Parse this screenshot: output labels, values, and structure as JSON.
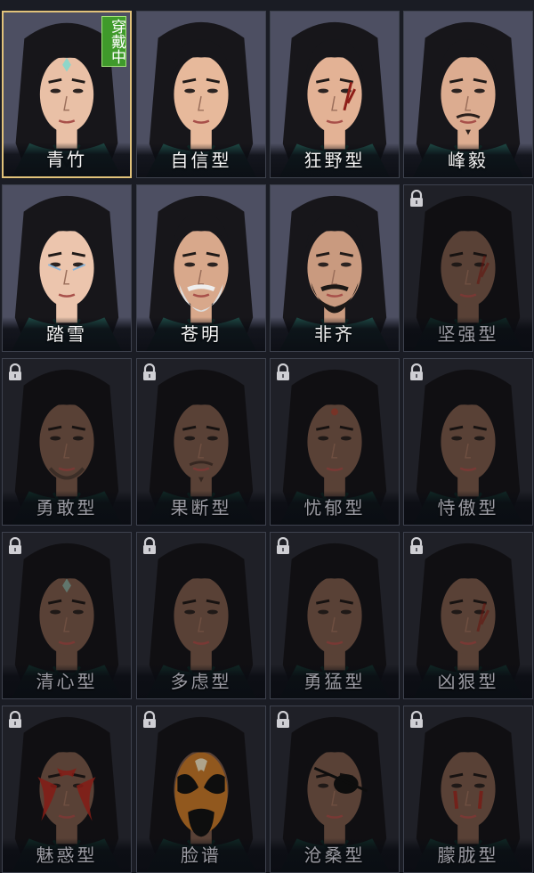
{
  "worn_badge": "穿戴中",
  "face_styles": [
    {
      "name": "青竹",
      "worn": true,
      "locked": false,
      "skin": "#e9c0a6",
      "marking": "forehead-gem"
    },
    {
      "name": "自信型",
      "worn": false,
      "locked": false,
      "skin": "#e7b99b",
      "marking": "none"
    },
    {
      "name": "狂野型",
      "worn": false,
      "locked": false,
      "skin": "#e3b295",
      "marking": "scar"
    },
    {
      "name": "峰毅",
      "worn": false,
      "locked": false,
      "skin": "#dcac90",
      "marking": "moustache"
    },
    {
      "name": "踏雪",
      "worn": false,
      "locked": false,
      "skin": "#ecc5ad",
      "marking": "eye-paint"
    },
    {
      "name": "苍明",
      "worn": false,
      "locked": false,
      "skin": "#d8a88b",
      "marking": "white-beard"
    },
    {
      "name": "非齐",
      "worn": false,
      "locked": false,
      "skin": "#c99a7f",
      "marking": "black-beard"
    },
    {
      "name": "坚强型",
      "worn": false,
      "locked": true,
      "skin": "#7c5b4b",
      "marking": "scar"
    },
    {
      "name": "勇敢型",
      "worn": false,
      "locked": true,
      "skin": "#7c5b4b",
      "marking": "stubble"
    },
    {
      "name": "果断型",
      "worn": false,
      "locked": true,
      "skin": "#7c5b4b",
      "marking": "moustache"
    },
    {
      "name": "忧郁型",
      "worn": false,
      "locked": true,
      "skin": "#7c5b4b",
      "marking": "forehead-mark"
    },
    {
      "name": "恃傲型",
      "worn": false,
      "locked": true,
      "skin": "#7c5b4b",
      "marking": "none"
    },
    {
      "name": "清心型",
      "worn": false,
      "locked": true,
      "skin": "#7c5b4b",
      "marking": "forehead-gem"
    },
    {
      "name": "多虑型",
      "worn": false,
      "locked": true,
      "skin": "#7c5b4b",
      "marking": "none"
    },
    {
      "name": "勇猛型",
      "worn": false,
      "locked": true,
      "skin": "#7c5b4b",
      "marking": "none"
    },
    {
      "name": "凶狠型",
      "worn": false,
      "locked": true,
      "skin": "#7c5b4b",
      "marking": "scar"
    },
    {
      "name": "魅惑型",
      "worn": false,
      "locked": true,
      "skin": "#7c5b4b",
      "marking": "red-paint"
    },
    {
      "name": "脸谱",
      "worn": false,
      "locked": true,
      "skin": "#7c5b4b",
      "marking": "opera-mask"
    },
    {
      "name": "沧桑型",
      "worn": false,
      "locked": true,
      "skin": "#7c5b4b",
      "marking": "eyepatch"
    },
    {
      "name": "朦胧型",
      "worn": false,
      "locked": true,
      "skin": "#7c5b4b",
      "marking": "red-streaks"
    }
  ],
  "colors": {
    "worn_border": "#e1c27a",
    "worn_badge_bg": "#3f9a2b",
    "card_bg_unlocked": "#4d4f62",
    "card_bg_locked": "#2c2d36",
    "hair": "#17161a",
    "robe": "#1e4a45"
  }
}
